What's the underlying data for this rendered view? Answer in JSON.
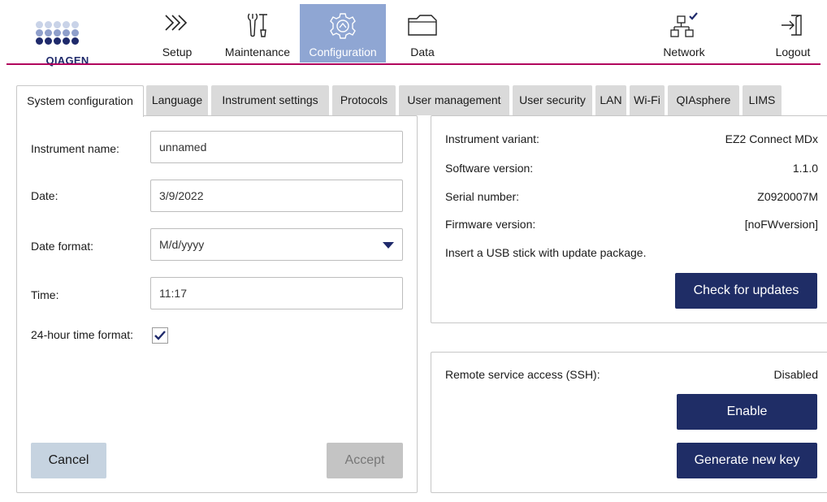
{
  "brand": {
    "name": "QIAGEN",
    "primary_color": "#1f2a6b",
    "accent_color": "#b1005d"
  },
  "nav": {
    "setup": {
      "label": "Setup",
      "icon": "chevrons-right-icon"
    },
    "maintenance": {
      "label": "Maintenance",
      "icon": "tools-icon"
    },
    "configuration": {
      "label": "Configuration",
      "icon": "gear-icon",
      "active": true
    },
    "data": {
      "label": "Data",
      "icon": "folder-icon"
    },
    "network": {
      "label": "Network",
      "icon": "network-icon"
    },
    "logout": {
      "label": "Logout",
      "icon": "logout-icon"
    }
  },
  "tabs": [
    {
      "label": "System configuration",
      "active": true
    },
    {
      "label": "Language"
    },
    {
      "label": "Instrument settings"
    },
    {
      "label": "Protocols"
    },
    {
      "label": "User management"
    },
    {
      "label": "User security"
    },
    {
      "label": "LAN"
    },
    {
      "label": "Wi-Fi"
    },
    {
      "label": "QIAsphere"
    },
    {
      "label": "LIMS"
    }
  ],
  "form": {
    "instrument_name": {
      "label": "Instrument name:",
      "value": "unnamed"
    },
    "date": {
      "label": "Date:",
      "value": "3/9/2022"
    },
    "date_format": {
      "label": "Date format:",
      "value": "M/d/yyyy"
    },
    "time": {
      "label": "Time:",
      "value": "11:17"
    },
    "time_format_24h": {
      "label": "24-hour time format:",
      "checked": true
    },
    "cancel_label": "Cancel",
    "accept_label": "Accept"
  },
  "info": {
    "variant": {
      "label": "Instrument variant:",
      "value": "EZ2 Connect MDx"
    },
    "software": {
      "label": "Software version:",
      "value": "1.1.0"
    },
    "serial": {
      "label": "Serial number:",
      "value": "Z0920007M"
    },
    "firmware": {
      "label": "Firmware version:",
      "value": "[noFWversion]"
    },
    "usb_message": "Insert a USB stick with update package.",
    "check_updates_label": "Check for updates"
  },
  "remote": {
    "label": "Remote service access (SSH):",
    "status": "Disabled",
    "enable_label": "Enable",
    "generate_key_label": "Generate new key"
  }
}
